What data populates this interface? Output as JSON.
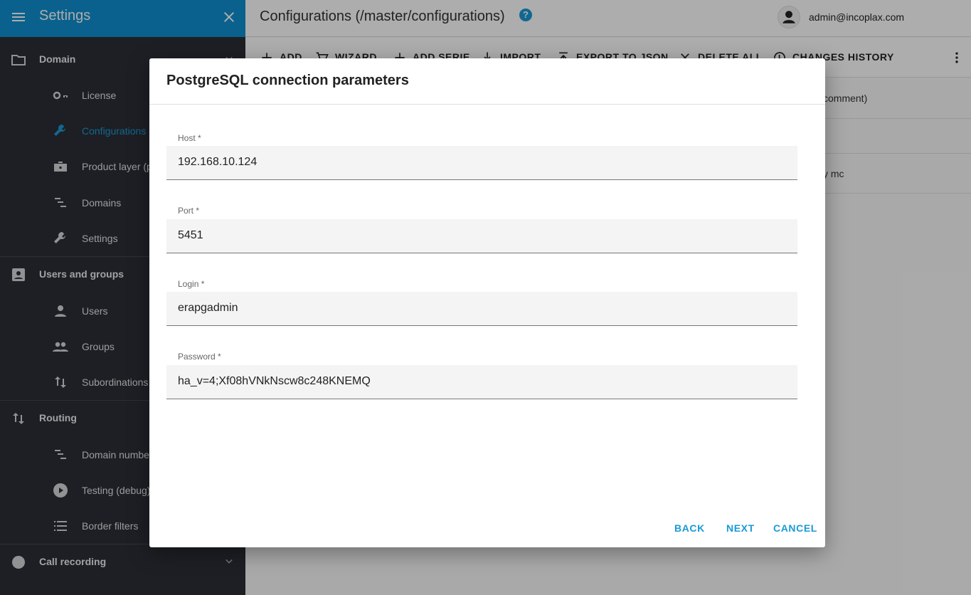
{
  "sidebar": {
    "title": "Settings",
    "sections": {
      "domain": "Domain",
      "users_groups": "Users and groups",
      "routing": "Routing",
      "call_recording": "Call recording"
    },
    "domain_items": [
      "License",
      "Configurations",
      "Product layer (p",
      "Domains",
      "Settings"
    ],
    "users_items": [
      "Users",
      "Groups",
      "Subordinations"
    ],
    "routing_items": [
      "Domain numbe",
      "Testing (debug)",
      "Border filters"
    ]
  },
  "header": {
    "page_title": "Configurations (/master/configurations)",
    "help_icon": "?",
    "user_email": "admin@incoplax.com"
  },
  "toolbar": {
    "add": "ADD",
    "wizard": "WIZARD",
    "add_serie": "ADD SERIE",
    "import": "IMPORT",
    "export": "EXPORT TO JSON",
    "delete_all": "DELETE ALL",
    "history": "CHANGES HISTORY"
  },
  "table_fragments": [
    "comment)",
    "y mc"
  ],
  "dialog": {
    "title": "PostgreSQL connection parameters",
    "fields": {
      "host": {
        "label": "Host *",
        "value": "192.168.10.124"
      },
      "port": {
        "label": "Port *",
        "value": "5451"
      },
      "login": {
        "label": "Login *",
        "value": "erapgadmin"
      },
      "password": {
        "label": "Password *",
        "value": "ha_v=4;Xf08hVNkNscw8c248KNEMQ"
      }
    },
    "actions": {
      "back": "BACK",
      "next": "NEXT",
      "cancel": "CANCEL"
    }
  },
  "colors": {
    "accent": "#0f8fd0",
    "sidebar_bg": "#2b2e35",
    "link": "#1a9ad6"
  }
}
